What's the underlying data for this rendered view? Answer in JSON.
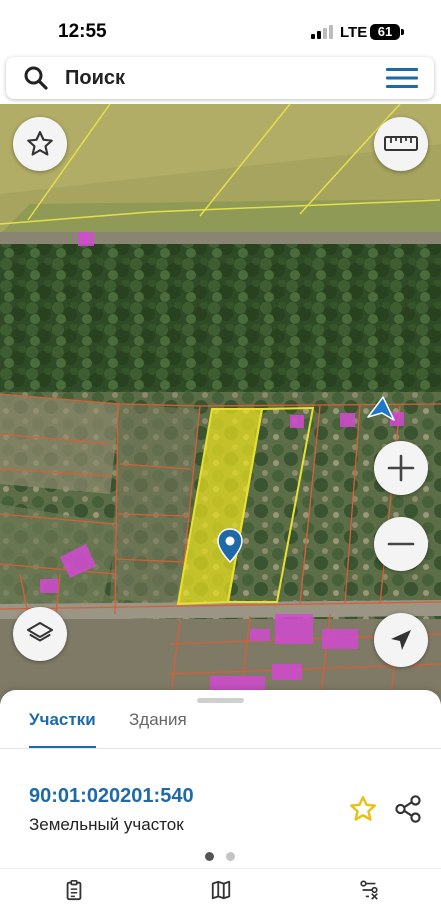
{
  "status_bar": {
    "time": "12:55",
    "network": "LTE",
    "battery": "61"
  },
  "search": {
    "label": "Поиск",
    "search_icon": "search-icon",
    "menu_icon": "hamburger-menu-icon"
  },
  "map": {
    "controls": {
      "favorite_icon": "star-outline-icon",
      "ruler_icon": "ruler-icon",
      "zoom_in_icon": "plus-icon",
      "zoom_out_icon": "minus-icon",
      "layers_icon": "layers-icon",
      "locate_icon": "navigation-arrow-icon"
    },
    "colors": {
      "parcel_highlight": "#f0e61e",
      "parcel_border": "#e8e030",
      "cadastral_lines": "#d4603a",
      "buildings": "#d24ad2",
      "marker": "#1e6aa8"
    }
  },
  "sheet": {
    "tabs": [
      {
        "label": "Участки",
        "active": true
      },
      {
        "label": "Здания",
        "active": false
      }
    ],
    "parcel": {
      "number": "90:01:020201:540",
      "type": "Земельный участок"
    },
    "actions": {
      "favorite_icon": "star-icon",
      "share_icon": "share-icon",
      "accent": "#e8c21a"
    },
    "pagination": {
      "pages": 2,
      "current": 1
    }
  },
  "bottom_nav": [
    {
      "icon": "clipboard-icon"
    },
    {
      "icon": "map-icon"
    },
    {
      "icon": "route-settings-icon"
    }
  ],
  "colors": {
    "accent": "#1e6aa8",
    "text": "#222222"
  }
}
